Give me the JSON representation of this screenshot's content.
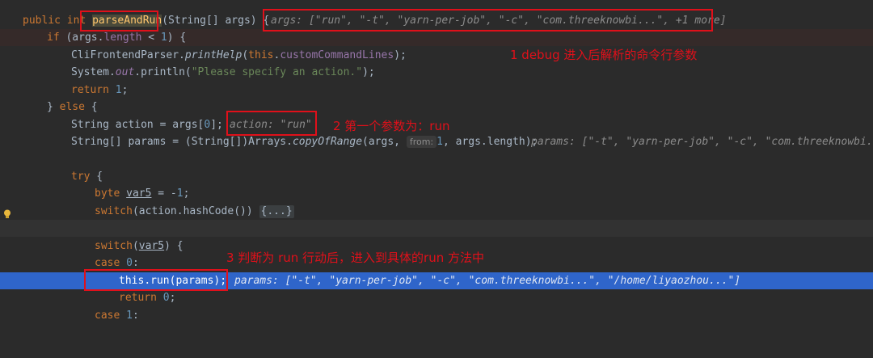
{
  "code": {
    "l1": {
      "kw1": "public",
      "kw2": "int",
      "fn": "parseAndRun",
      "rest": "(String[] args) {",
      "hint": "args: [\"run\", \"-t\", \"yarn-per-job\", \"-c\", \"com.threeknowbi...\", +1 more]"
    },
    "l2": {
      "kw": "if",
      "a": " (args.",
      "field": "length",
      "b": " < ",
      "num": "1",
      "c": ") {"
    },
    "l3": {
      "a": "CliFrontendParser.",
      "fn": "printHelp",
      "b": "(",
      "kw": "this",
      "c": ".",
      "field": "customCommandLines",
      "d": ");"
    },
    "l4": {
      "a": "System.",
      "field": "out",
      "b": ".println(",
      "str": "\"Please specify an action.\"",
      "c": ");"
    },
    "l5": {
      "kw": "return",
      "num": " 1",
      "c": ";"
    },
    "l6": {
      "a": "} ",
      "kw": "else",
      "b": " {"
    },
    "l7": {
      "a": "String action = args[",
      "num": "0",
      "b": "];",
      "hint": "action: \"run\""
    },
    "l8": {
      "a": "String[] params = (String[])Arrays.",
      "fn": "copyOfRange",
      "b": "(args,",
      "param_hint": "from:",
      "num": "1",
      "c": ", args.length);",
      "hint": "params: [\"-t\", \"yarn-per-job\", \"-c\", \"com.threeknowbi..."
    },
    "l10": {
      "kw": "try",
      "b": " {"
    },
    "l11": {
      "kw": "byte",
      "var": "var5",
      "b": " = -",
      "num": "1",
      "c": ";"
    },
    "l12": {
      "kw": "switch",
      "b": "(action.hashCode())",
      "fold": "{...}"
    },
    "l14": {
      "kw": "switch",
      "a": "(",
      "var": "var5",
      "b": ") {"
    },
    "l15": {
      "kw": "case",
      "num": " 0",
      "b": ":"
    },
    "l16": {
      "kw": "this",
      "a": ".run(params);",
      "hint": "params: [\"-t\", \"yarn-per-job\", \"-c\", \"com.threeknowbi...\", \"/home/liyaozhou...\"]"
    },
    "l17": {
      "kw": "return",
      "num": " 0",
      "b": ";"
    },
    "l18": {
      "kw": "case",
      "num": " 1",
      "b": ":"
    }
  },
  "annotations": {
    "a1": "1 debug 进入后解析的命令行参数",
    "a2": "2 第一个参数为：run",
    "a3": "3 判断为 run 行动后，进入到具体的run 方法中"
  },
  "colors": {
    "background": "#2b2b2b",
    "current_line": "#2f65ca",
    "annotation_red": "#e0101a",
    "keyword": "#cc7832",
    "method": "#ffc66d",
    "string": "#6a8759",
    "number": "#6897bb"
  },
  "icons": {
    "gutter": "lightbulb-icon"
  }
}
